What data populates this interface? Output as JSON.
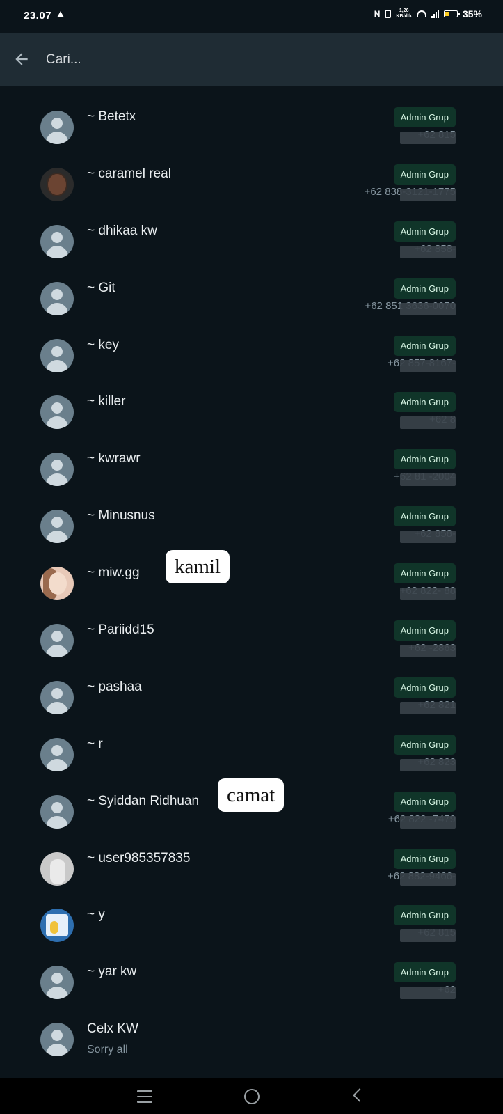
{
  "status_bar": {
    "time": "23.07",
    "network_speed_value": "1,26",
    "network_speed_unit": "KB/dtk",
    "battery_percent": "35%",
    "nfc_label": "N"
  },
  "search": {
    "placeholder": "Cari..."
  },
  "contacts": [
    {
      "name": "~ Betetx",
      "badge": "Admin Grup",
      "phone": "+62 815 "
    },
    {
      "name": "~ caramel real",
      "badge": "Admin Grup",
      "phone": "+62 838-3121-1775"
    },
    {
      "name": "~ dhikaa kw",
      "badge": "Admin Grup",
      "phone": "+62 858-"
    },
    {
      "name": "~ Git",
      "badge": "Admin Grup",
      "phone": "+62 851 3636-0070"
    },
    {
      "name": "~ key",
      "badge": "Admin Grup",
      "phone": "+62 857-8167-"
    },
    {
      "name": "~ killer",
      "badge": "Admin Grup",
      "phone": "+62 8"
    },
    {
      "name": "~ kwrawr",
      "badge": "Admin Grup",
      "phone": "+62 81 -2004"
    },
    {
      "name": "~ Minusnus",
      "badge": "Admin Grup",
      "phone": "+62 858-"
    },
    {
      "name": "~ miw.gg",
      "badge": "Admin Grup",
      "phone": "+62 822-  88",
      "sticker": "kamil"
    },
    {
      "name": "~ Pariidd15",
      "badge": "Admin Grup",
      "phone": "+62 -2863"
    },
    {
      "name": "~ pashaa",
      "badge": "Admin Grup",
      "phone": "+62 821"
    },
    {
      "name": "~ r",
      "badge": "Admin Grup",
      "phone": "+62 823"
    },
    {
      "name": "~ Syiddan Ridhuan",
      "badge": "Admin Grup",
      "phone": "+62 822 -7479",
      "sticker": "camat"
    },
    {
      "name": "~ user985357835",
      "badge": "Admin Grup",
      "phone": "+62 882-9466-"
    },
    {
      "name": "~ y",
      "badge": "Admin Grup",
      "phone": "+62 815"
    },
    {
      "name": "~ yar kw",
      "badge": "Admin Grup",
      "phone": "+62"
    },
    {
      "name": "Celx KW",
      "subtext": "Sorry all"
    }
  ],
  "colors": {
    "background": "#0b141a",
    "header": "#1f2c34",
    "badge_bg": "#103529",
    "badge_text": "#d7f5e4",
    "secondary_text": "#8696a0",
    "battery": "#fccc20"
  },
  "icons": {
    "back": "back-arrow-icon",
    "default_avatar": "default-avatar-icon",
    "nav_recents": "menu-icon",
    "nav_home": "home-circle-icon",
    "nav_back": "chevron-left-icon"
  }
}
